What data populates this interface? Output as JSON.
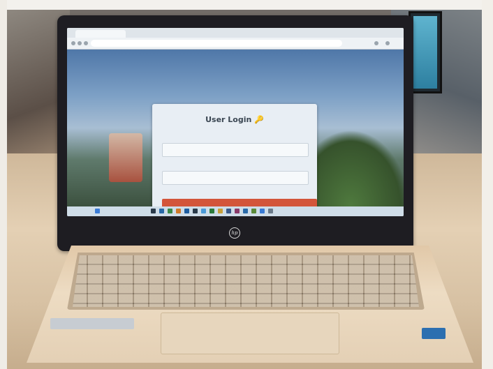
{
  "screen": {
    "browser_tab": "",
    "browser_url": "",
    "login": {
      "title": "User Login",
      "title_icon": "key-icon",
      "subtitle": "",
      "username_label": "",
      "password_label": "",
      "login_button": "",
      "alt_button": "",
      "register_button": ""
    }
  },
  "device": {
    "brand_logo": "hp"
  },
  "colors": {
    "login_button": "#d3553a",
    "secondary_buttons": "#3d5670",
    "sticker": "#2c6fb0"
  }
}
